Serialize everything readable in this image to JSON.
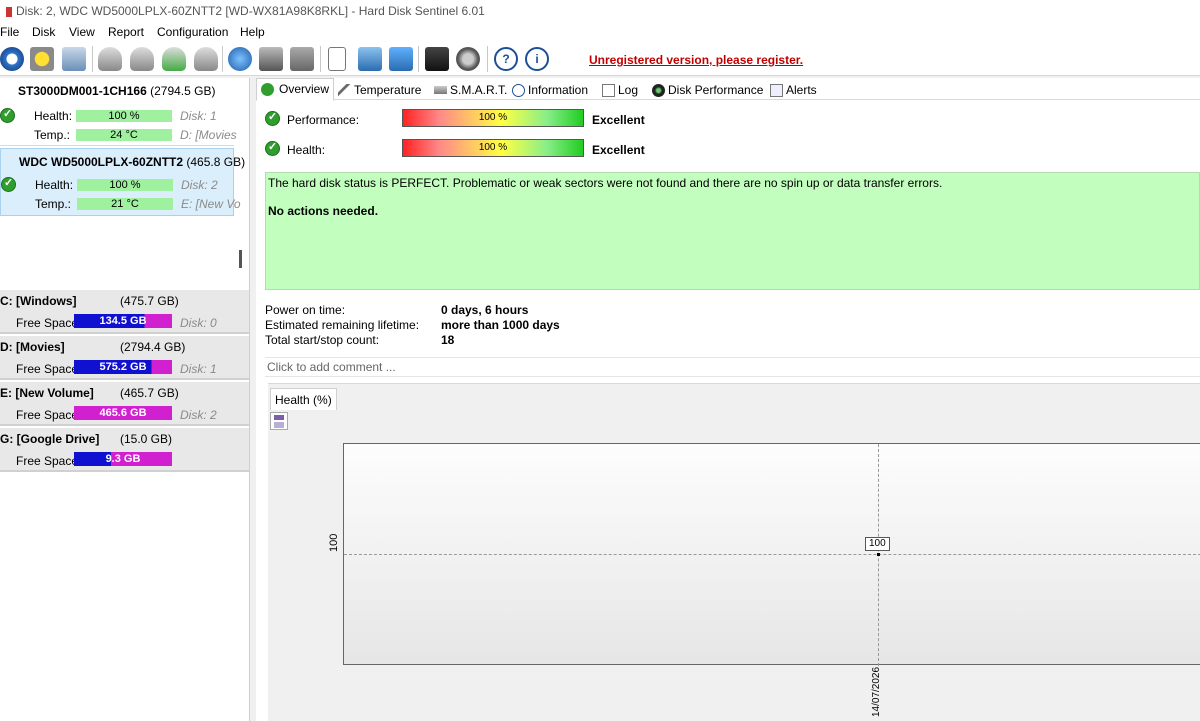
{
  "title": "Disk: 2, WDC WD5000LPLX-60ZNTT2 [WD-WX81A98K8RKL]  -  Hard Disk Sentinel 6.01",
  "menu": [
    "File",
    "Disk",
    "View",
    "Report",
    "Configuration",
    "Help"
  ],
  "register_notice": "Unregistered version, please register.",
  "toolbar_icons": [
    "refresh-icon",
    "warning-icon",
    "disk-image-icon",
    "hdd-test-icon",
    "hdd-test2-icon",
    "hdd-check-icon",
    "hdd-repair-icon",
    "globe-icon",
    "printer-icon",
    "disk-swap-icon",
    "document-icon",
    "sync-icon",
    "network-icon",
    "monitor-icon",
    "gear-icon",
    "help-icon",
    "info-icon"
  ],
  "disks": [
    {
      "name": "ST3000DM001-1CH166",
      "size": "(2794.5 GB)",
      "health_label": "Health:",
      "health": "100 %",
      "temp_label": "Temp.:",
      "temp": "24 °C",
      "disk": "Disk: 1",
      "vol": "D: [Movies"
    },
    {
      "name": "WDC WD5000LPLX-60ZNTT2",
      "size": "(465.8 GB)",
      "health_label": "Health:",
      "health": "100 %",
      "temp_label": "Temp.:",
      "temp": "21 °C",
      "disk": "Disk: 2",
      "vol": "E: [New Vo"
    }
  ],
  "volumes": [
    {
      "name": "C: [Windows]",
      "size": "(475.7 GB)",
      "free_label": "Free Space",
      "free": "134.5 GB",
      "free_fraction": 0.28,
      "disk": "Disk: 0"
    },
    {
      "name": "D: [Movies]",
      "size": "(2794.4 GB)",
      "free_label": "Free Space",
      "free": "575.2 GB",
      "free_fraction": 0.21,
      "disk": "Disk: 1"
    },
    {
      "name": "E: [New Volume]",
      "size": "(465.7 GB)",
      "free_label": "Free Space",
      "free": "465.6 GB",
      "free_fraction": 1.0,
      "disk": "Disk: 2"
    },
    {
      "name": "G: [Google Drive]",
      "size": "(15.0 GB)",
      "free_label": "Free Space",
      "free": "9.3 GB",
      "free_fraction": 0.62,
      "disk": ""
    }
  ],
  "tabs": [
    "Overview",
    "Temperature",
    "S.M.A.R.T.",
    "Information",
    "Log",
    "Disk Performance",
    "Alerts"
  ],
  "overview": {
    "performance_label": "Performance:",
    "performance_value": "100 %",
    "performance_rating": "Excellent",
    "health_label": "Health:",
    "health_value": "100 %",
    "health_rating": "Excellent",
    "status_text": "The hard disk status is PERFECT. Problematic or weak sectors were not found and there are no spin up or data transfer errors.",
    "status_action": "No actions needed.",
    "power_on_label": "Power on time:",
    "power_on_value": "0 days, 6 hours",
    "lifetime_label": "Estimated remaining lifetime:",
    "lifetime_value": "more than 1000 days",
    "startstop_label": "Total start/stop count:",
    "startstop_value": "18",
    "comment_placeholder": "Click to add comment ..."
  },
  "chart_data": {
    "type": "line",
    "title": "Health (%)",
    "x": [
      "14/07/2026"
    ],
    "series": [
      {
        "name": "Health (%)",
        "values": [
          100
        ]
      }
    ],
    "ytick_labels": [
      "100"
    ],
    "data_labels": [
      "100"
    ],
    "grid": true
  }
}
